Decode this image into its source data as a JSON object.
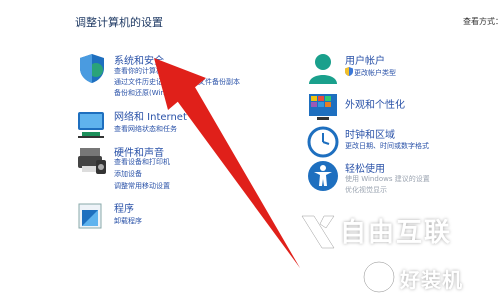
{
  "header": {
    "title": "调整计算机的设置",
    "view_by": "查看方式："
  },
  "categories": {
    "security": {
      "title": "系统和安全",
      "links": [
        "查看你的计算机状态",
        "通过文件历史记录保存你的文件备份副本",
        "备份和还原(Windows 7)"
      ]
    },
    "network": {
      "title": "网络和 Internet",
      "links": [
        "查看网络状态和任务"
      ]
    },
    "hardware": {
      "title": "硬件和声音",
      "links": [
        "查看设备和打印机",
        "添加设备",
        "调整常用移动设置"
      ]
    },
    "programs": {
      "title": "程序",
      "links": [
        "卸载程序"
      ]
    },
    "accounts": {
      "title": "用户帐户",
      "links": [
        "更改帐户类型"
      ]
    },
    "appearance": {
      "title": "外观和个性化",
      "links": []
    },
    "clock": {
      "title": "时钟和区域",
      "links": [
        "更改日期、时间或数字格式"
      ]
    },
    "ease": {
      "title": "轻松使用",
      "links": [
        "使用 Windows 建议的设置",
        "优化视觉显示"
      ]
    }
  },
  "watermark": {
    "brand_top": "自由互联",
    "brand_bottom": "好装机"
  },
  "colors": {
    "link": "#2a52a8",
    "arrow": "#e0201a"
  }
}
